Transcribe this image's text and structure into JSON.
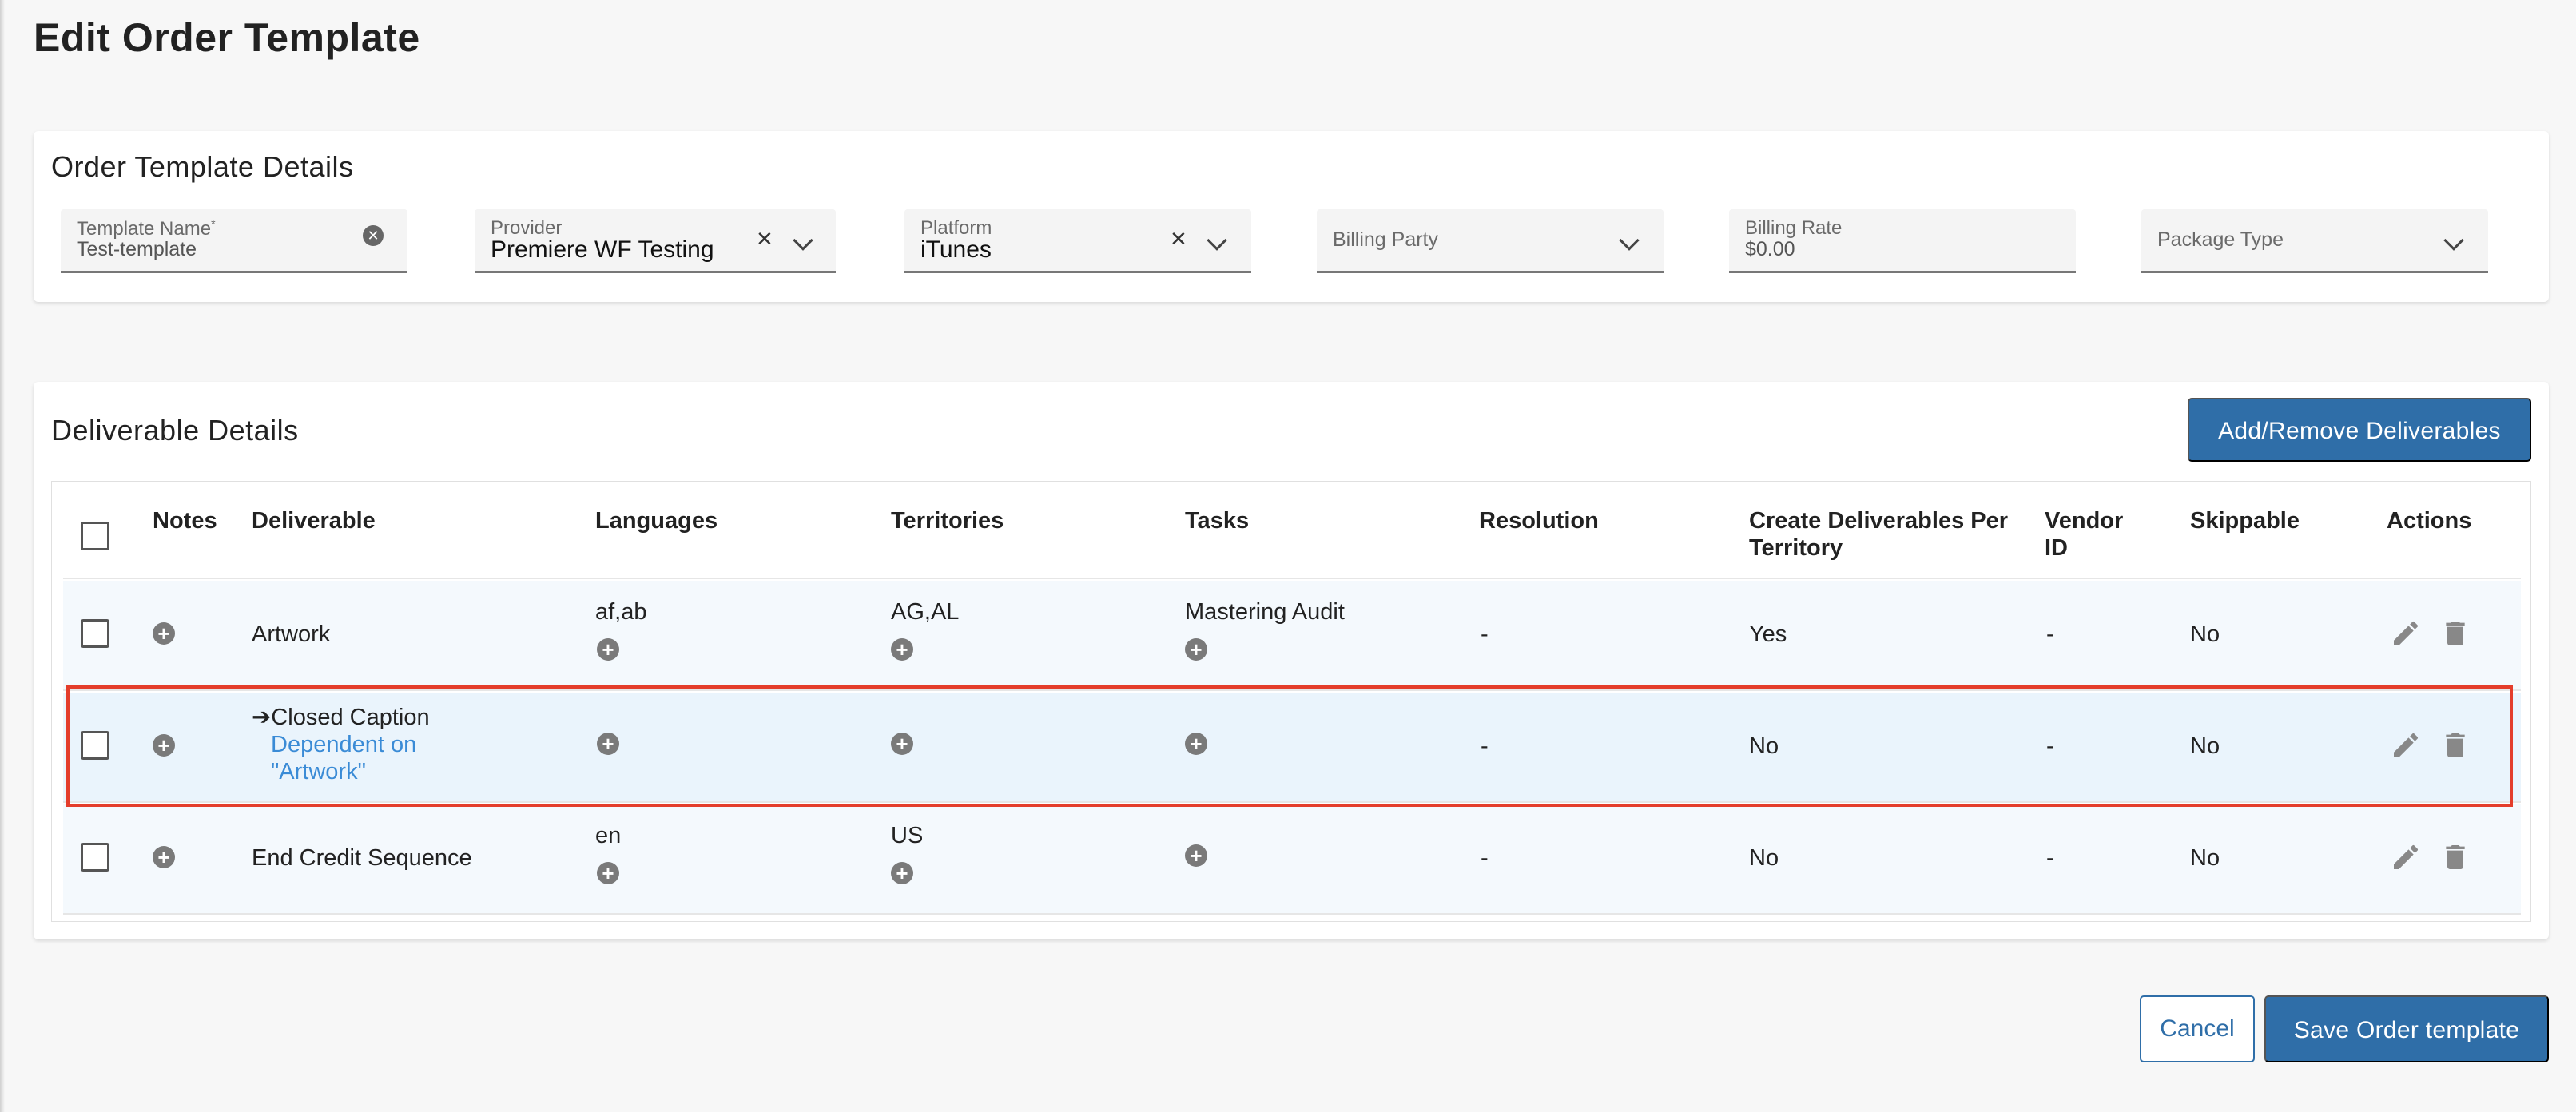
{
  "page": {
    "title": "Edit Order Template"
  },
  "details": {
    "title": "Order Template Details",
    "template_name": {
      "label": "Template Name",
      "required_mark": "*",
      "value": "Test-template"
    },
    "provider": {
      "label": "Provider",
      "value": "Premiere WF Testing"
    },
    "platform": {
      "label": "Platform",
      "value": "iTunes"
    },
    "billing_party": {
      "label": "Billing Party"
    },
    "billing_rate": {
      "label": "Billing Rate",
      "value": "$0.00"
    },
    "package_type": {
      "label": "Package Type"
    }
  },
  "deliverables": {
    "title": "Deliverable Details",
    "add_remove_label": "Add/Remove Deliverables",
    "columns": {
      "notes": "Notes",
      "deliverable": "Deliverable",
      "languages": "Languages",
      "territories": "Territories",
      "tasks": "Tasks",
      "resolution": "Resolution",
      "create_per_territory": "Create Deliverables Per Territory",
      "vendor_id": "Vendor ID",
      "skippable": "Skippable",
      "actions": "Actions"
    },
    "rows": [
      {
        "deliverable": "Artwork",
        "languages": "af,ab",
        "territories": "AG,AL",
        "tasks": "Mastering Audit",
        "resolution": "-",
        "create_per_territory": "Yes",
        "vendor_id": "-",
        "skippable": "No"
      },
      {
        "deliverable": "Closed Caption",
        "dependency": "Dependent on \"Artwork\"",
        "languages": "",
        "territories": "",
        "tasks": "",
        "resolution": "-",
        "create_per_territory": "No",
        "vendor_id": "-",
        "skippable": "No"
      },
      {
        "deliverable": "End Credit Sequence",
        "languages": "en",
        "territories": "US",
        "tasks": "",
        "resolution": "-",
        "create_per_territory": "No",
        "vendor_id": "-",
        "skippable": "No"
      }
    ]
  },
  "footer": {
    "cancel_label": "Cancel",
    "save_label": "Save Order template"
  },
  "colors": {
    "primary": "#2f6ea8",
    "highlight_border": "#e43d2b",
    "link": "#3a8bd6"
  }
}
